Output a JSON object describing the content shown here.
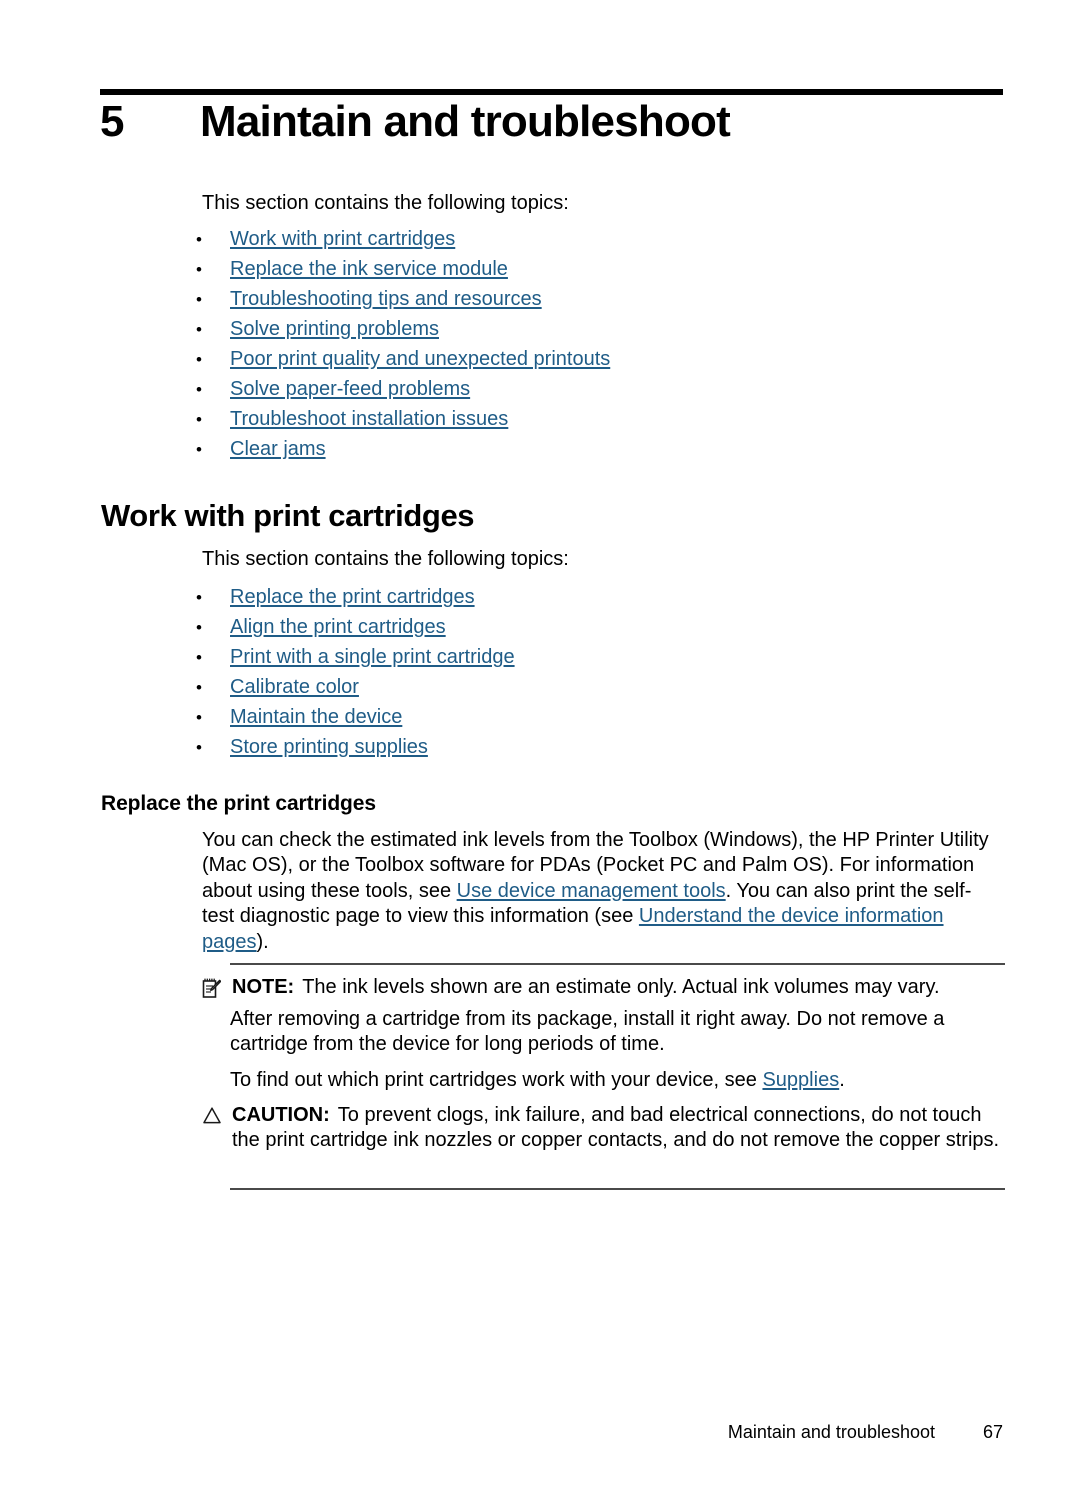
{
  "chapter": {
    "number": "5",
    "title": "Maintain and troubleshoot"
  },
  "intro": {
    "text": "This section contains the following topics:"
  },
  "topics_chapter": [
    {
      "label": "Work with print cartridges"
    },
    {
      "label": "Replace the ink service module"
    },
    {
      "label": "Troubleshooting tips and resources"
    },
    {
      "label": "Solve printing problems"
    },
    {
      "label": "Poor print quality and unexpected printouts"
    },
    {
      "label": "Solve paper-feed problems"
    },
    {
      "label": "Troubleshoot installation issues"
    },
    {
      "label": "Clear jams"
    }
  ],
  "section": {
    "heading": "Work with print cartridges",
    "intro": "This section contains the following topics:",
    "topics": [
      {
        "label": "Replace the print cartridges"
      },
      {
        "label": "Align the print cartridges"
      },
      {
        "label": "Print with a single print cartridge"
      },
      {
        "label": "Calibrate color"
      },
      {
        "label": "Maintain the device"
      },
      {
        "label": "Store printing supplies"
      }
    ]
  },
  "subsection": {
    "heading": "Replace the print cartridges",
    "paragraph": {
      "part1": "You can check the estimated ink levels from the Toolbox (Windows), the HP Printer Utility (Mac OS), or the Toolbox software for PDAs (Pocket PC and Palm OS). For information about using these tools, see ",
      "link1": "Use device management tools",
      "part2": ". You can also print the self-test diagnostic page to view this information (see ",
      "link2": "Understand the device information pages",
      "part3": ")."
    }
  },
  "note": {
    "label": "NOTE:",
    "icon": "notepad-pencil-icon",
    "text": "The ink levels shown are an estimate only. Actual ink volumes may vary."
  },
  "after_note": {
    "text": "After removing a cartridge from its package, install it right away. Do not remove a cartridge from the device for long periods of time."
  },
  "supplies": {
    "part1": "To find out which print cartridges work with your device, see ",
    "link": "Supplies",
    "part2": "."
  },
  "caution": {
    "label": "CAUTION:",
    "icon": "warning-triangle-icon",
    "text": "To prevent clogs, ink failure, and bad electrical connections, do not touch the print cartridge ink nozzles or copper contacts, and do not remove the copper strips."
  },
  "footer": {
    "title": "Maintain and troubleshoot",
    "page": "67"
  },
  "colors": {
    "link": "#1f5c87",
    "text": "#000000",
    "rule": "#4a4a4a",
    "chapter_rule": "#000000"
  },
  "bullet_glyph": "•"
}
